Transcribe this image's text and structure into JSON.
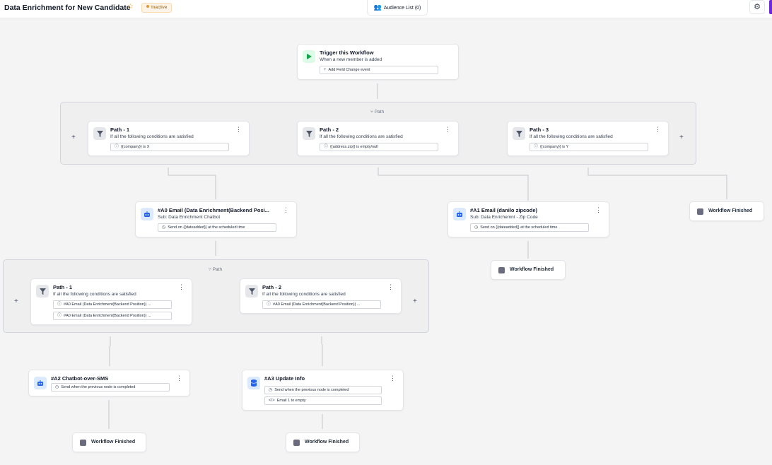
{
  "header": {
    "title": "Data Enrichment for New Candidate",
    "status": "Inactive",
    "audience_button": "Audience List (0)"
  },
  "trigger": {
    "title": "Trigger this Workflow",
    "subtitle": "When a new member is added",
    "add_button": "Add Field Change event"
  },
  "groups": {
    "top_label": "Path",
    "bottom_label": "Path"
  },
  "paths_top": [
    {
      "title": "Path - 1",
      "subtitle": "If all the following conditions are satisfied",
      "conditions": [
        "{{company}} is X"
      ]
    },
    {
      "title": "Path - 2",
      "subtitle": "If all the following conditions are satisfied",
      "conditions": [
        "{{address.zip}} is empty/null"
      ]
    },
    {
      "title": "Path - 3",
      "subtitle": "If all the following conditions are satisfied",
      "conditions": [
        "{{company}} is Y"
      ]
    }
  ],
  "actions": {
    "a0": {
      "title": "#A0 Email (Data Enrichment(Backend Posi...",
      "subtitle": "Sub: Data Enrichment Chatbot",
      "chip": "Send on {{dateadded}} at the scheduled time"
    },
    "a1": {
      "title": "#A1 Email (danilo zipcode)",
      "subtitle": "Sub: Data Enrichemnt - Zip Code",
      "chip": "Send on {{dateadded}} at the scheduled time"
    },
    "a2": {
      "title": "#A2 Chatbot-over-SMS",
      "chip": "Send when the previous node is completed"
    },
    "a3": {
      "title": "#A3 Update Info",
      "chip": "Send when the previous node is completed",
      "chip2": "Email 1 to empty"
    }
  },
  "paths_bottom": [
    {
      "title": "Path - 1",
      "subtitle": "If all the following conditions are satisfied",
      "conditions": [
        "#A0 Email (Data Enrichment(Backend Position)) ...",
        "#A0 Email (Data Enrichment(Backend Position)) ..."
      ]
    },
    {
      "title": "Path - 2",
      "subtitle": "If all the following conditions are satisfied",
      "conditions": [
        "#A0 Email (Data Enrichment(Backend Position)) ..."
      ]
    }
  ],
  "finish_label": "Workflow Finished",
  "icons": {
    "chevron": "chevron-down-icon",
    "star": "star-icon",
    "audience": "people-icon",
    "gear": "gear-icon",
    "play": "play-icon",
    "filter": "filter-icon",
    "bot": "robot-icon",
    "db": "database-icon",
    "info": "info-icon",
    "clock": "clock-icon",
    "code": "code-icon",
    "stop": "stop-icon",
    "branch": "branch-icon"
  },
  "colors": {
    "accent": "#2563eb",
    "trigger_green": "#16a34a",
    "status_dot": "#e39a2b",
    "finish_square": "#6b6b80",
    "brand_purple": "#6d28d9"
  }
}
